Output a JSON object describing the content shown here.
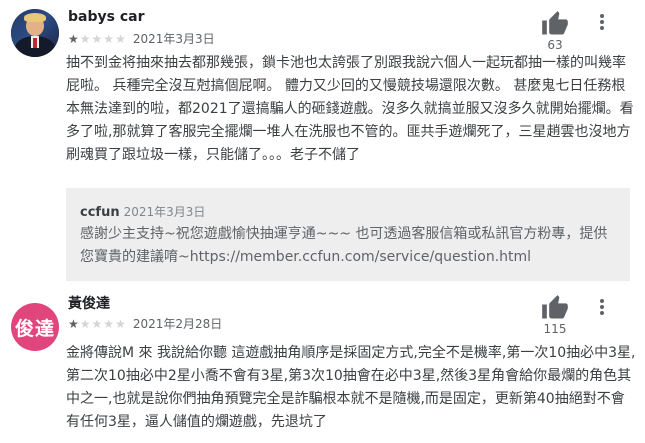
{
  "reviews": [
    {
      "username": "babys car",
      "rating": 1,
      "max_rating": 5,
      "date": "2021年3月3日",
      "likes": "63",
      "text": "抽不到金将抽來抽去都那幾張，鎖卡池也太誇張了別跟我說六個人一起玩都抽一樣的叫幾率屁啦。 兵種完全沒互尅搞個屁啊。 體力又少回的又慢競技場還限次數。 甚麼鬼七日任務根本無法達到的啦，都2021了還搞騙人的砸錢遊戲。沒多久就搞並服又沒多久就開始擺爛。看多了啦,那就算了客服完全擺爛一堆人在洗服也不管的。匪共手遊爛死了，三星趙雲也沒地方刷魂買了跟垃圾一樣，只能儲了。。。老子不儲了",
      "reply": {
        "name": "ccfun",
        "date": "2021年3月3日",
        "text": "感謝少主支持~祝您遊戲愉快抽運亨通~~~ 也可透過客服信箱或私訊官方粉專，提供您寶貴的建議唷~https://member.ccfun.com/service/question.html"
      }
    },
    {
      "username": "黃俊達",
      "avatar_text": "俊達",
      "avatar_color": "#e0457b",
      "rating": 1,
      "max_rating": 5,
      "date": "2021年2月28日",
      "likes": "115",
      "text": "金將傳說M 來 我說給你聽 這遊戲抽角順序是採固定方式,完全不是機率,第一次10抽必中3星,第二次10抽必中2星小喬不會有3星,第3次10抽會在必中3星,然後3星角會給你最爛的角色其中之一,也就是說你們抽角預覽完全是詐騙根本就不是隨機,而是固定，更新第40抽絕對不會有任何3星，逼人儲值的爛遊戲，先退坑了"
    }
  ],
  "icons": {
    "like": "thumbs-up-icon",
    "more": "more-vert-icon",
    "star": "star-icon"
  }
}
